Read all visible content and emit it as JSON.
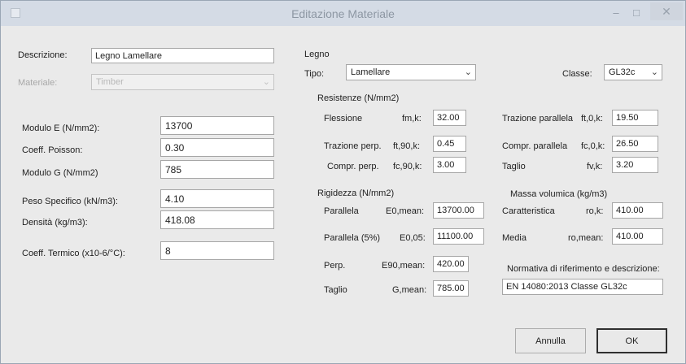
{
  "window": {
    "title": "Editazione Materiale",
    "minimize": "–",
    "maximize": "□",
    "close": "✕"
  },
  "left": {
    "descrizione_label": "Descrizione:",
    "descrizione_value": "Legno Lamellare",
    "materiale_label": "Materiale:",
    "materiale_value": "Timber",
    "fields": [
      {
        "label": "Modulo E (N/mm2):",
        "value": "13700"
      },
      {
        "label": "Coeff. Poisson:",
        "value": "0.30"
      },
      {
        "label": "Modulo G (N/mm2)",
        "value": "785"
      },
      {
        "label": "Peso Specifico (kN/m3):",
        "value": "4.10"
      },
      {
        "label": "Densità (kg/m3):",
        "value": "418.08"
      },
      {
        "label": "Coeff. Termico (x10-6/°C):",
        "value": "8"
      }
    ]
  },
  "legno": {
    "group_label": "Legno",
    "tipo_label": "Tipo:",
    "tipo_value": "Lamellare",
    "classe_label": "Classe:",
    "classe_value": "GL32c",
    "resistenze_label": "Resistenze (N/mm2)",
    "resistenze": [
      {
        "label": "Flessione",
        "symbol": "fm,k:",
        "value": "32.00"
      },
      {
        "label": "Trazione perp.",
        "symbol": "ft,90,k:",
        "value": "0.45"
      },
      {
        "label": "Compr. perp.",
        "symbol": "fc,90,k:",
        "value": "3.00"
      },
      {
        "label": "Trazione parallela",
        "symbol": "ft,0,k:",
        "value": "19.50"
      },
      {
        "label": "Compr. parallela",
        "symbol": "fc,0,k:",
        "value": "26.50"
      },
      {
        "label": "Taglio",
        "symbol": "fv,k:",
        "value": "3.20"
      }
    ],
    "rigidezza_label": "Rigidezza (N/mm2)",
    "rigidezza": [
      {
        "label": "Parallela",
        "symbol": "E0,mean:",
        "value": "13700.00"
      },
      {
        "label": "Parallela (5%)",
        "symbol": "E0,05:",
        "value": "11100.00"
      },
      {
        "label": "Perp.",
        "symbol": "E90,mean:",
        "value": "420.00"
      },
      {
        "label": "Taglio",
        "symbol": "G,mean:",
        "value": "785.00"
      }
    ],
    "massa_label": "Massa volumica (kg/m3)",
    "massa": [
      {
        "label": "Caratteristica",
        "symbol": "ro,k:",
        "value": "410.00"
      },
      {
        "label": "Media",
        "symbol": "ro,mean:",
        "value": "410.00"
      }
    ],
    "normativa_label": "Normativa di riferimento e descrizione:",
    "normativa_value": "EN 14080:2013 Classe GL32c"
  },
  "buttons": {
    "annulla": "Annulla",
    "ok": "OK"
  }
}
